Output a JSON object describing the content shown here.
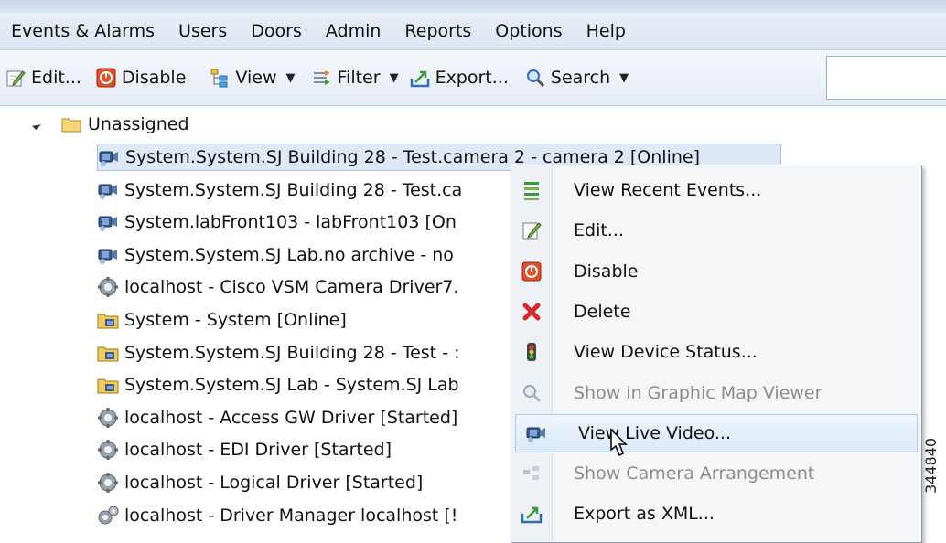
{
  "menu": [
    "Events & Alarms",
    "Users",
    "Doors",
    "Admin",
    "Reports",
    "Options",
    "Help"
  ],
  "toolbar": {
    "edit": "Edit...",
    "disable": "Disable",
    "view": "View",
    "filter": "Filter",
    "export": "Export...",
    "search": "Search",
    "dropdown_glyph": "▼"
  },
  "tree": {
    "root": "Unassigned",
    "items": [
      {
        "icon": "camera-icon",
        "label": "System.System.SJ Building 28 - Test.camera 2 - camera 2 [Online]"
      },
      {
        "icon": "camera-icon",
        "label": "System.System.SJ Building 28 - Test.ca"
      },
      {
        "icon": "camera-icon",
        "label": "System.labFront103 - labFront103 [On"
      },
      {
        "icon": "camera-icon",
        "label": "System.System.SJ Lab.no archive - no"
      },
      {
        "icon": "gear-icon",
        "label": "localhost - Cisco VSM Camera Driver7."
      },
      {
        "icon": "folder-camera-icon",
        "label": "System - System [Online]"
      },
      {
        "icon": "folder-camera-icon",
        "label": "System.System.SJ Building 28 - Test - :"
      },
      {
        "icon": "folder-camera-icon",
        "label": "System.System.SJ Lab - System.SJ Lab"
      },
      {
        "icon": "gear-icon",
        "label": "localhost - Access GW Driver [Started]"
      },
      {
        "icon": "gear-icon",
        "label": "localhost - EDI Driver [Started]"
      },
      {
        "icon": "gear-icon",
        "label": "localhost - Logical Driver [Started]"
      },
      {
        "icon": "gears-icon",
        "label": "localhost - Driver Manager localhost [!"
      }
    ]
  },
  "context_menu": [
    {
      "icon": "events-list-icon",
      "label": "View Recent Events...",
      "enabled": true
    },
    {
      "icon": "edit-icon",
      "label": "Edit...",
      "enabled": true
    },
    {
      "icon": "disable-icon",
      "label": "Disable",
      "enabled": true
    },
    {
      "icon": "delete-icon",
      "label": "Delete",
      "enabled": true
    },
    {
      "icon": "traffic-light-icon",
      "label": "View Device Status...",
      "enabled": true
    },
    {
      "icon": "map-viewer-icon",
      "label": "Show in Graphic Map Viewer",
      "enabled": false
    },
    {
      "icon": "camera-icon",
      "label": "View Live Video...",
      "enabled": true,
      "hovered": true
    },
    {
      "icon": "arrangement-icon",
      "label": "Show Camera Arrangement",
      "enabled": false
    },
    {
      "icon": "export-icon",
      "label": "Export as XML...",
      "enabled": true
    }
  ],
  "side_number": "344840",
  "colors": {
    "selection": "#dfe9f6",
    "menu_hover": "#dbe9f9",
    "disabled_text": "#8d8d8d"
  }
}
